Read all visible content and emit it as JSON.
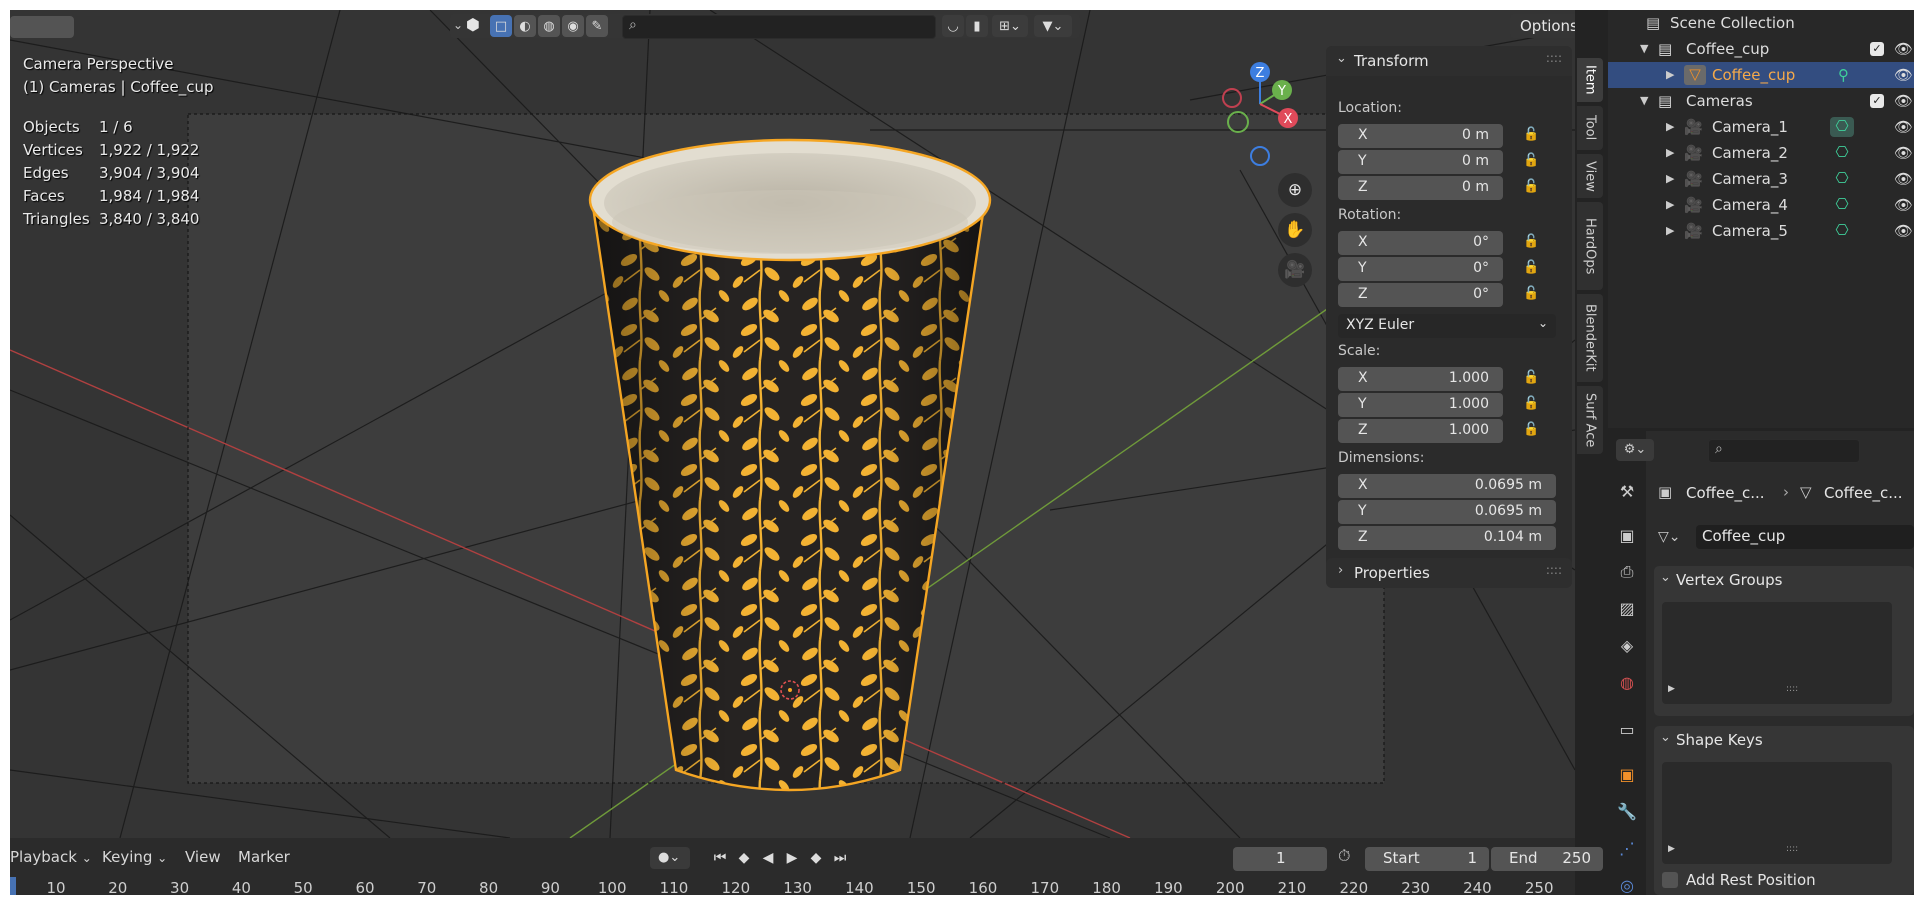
{
  "viewport": {
    "options_label": "Options",
    "camera_title": "Camera Perspective",
    "camera_subtitle": "(1) Cameras | Coffee_cup",
    "stats": [
      {
        "label": "Objects",
        "value": "1 / 6"
      },
      {
        "label": "Vertices",
        "value": "1,922 / 1,922"
      },
      {
        "label": "Edges",
        "value": "3,904 / 3,904"
      },
      {
        "label": "Faces",
        "value": "1,984 / 1,984"
      },
      {
        "label": "Triangles",
        "value": "3,840 / 3,840"
      }
    ],
    "gizmo_labels": {
      "z": "Z",
      "y": "Y",
      "x": "X"
    }
  },
  "npanel": {
    "transform_title": "Transform",
    "location_label": "Location:",
    "location": [
      {
        "axis": "X",
        "value": "0 m"
      },
      {
        "axis": "Y",
        "value": "0 m"
      },
      {
        "axis": "Z",
        "value": "0 m"
      }
    ],
    "rotation_label": "Rotation:",
    "rotation": [
      {
        "axis": "X",
        "value": "0°"
      },
      {
        "axis": "Y",
        "value": "0°"
      },
      {
        "axis": "Z",
        "value": "0°"
      }
    ],
    "rotation_mode": "XYZ Euler",
    "scale_label": "Scale:",
    "scale": [
      {
        "axis": "X",
        "value": "1.000"
      },
      {
        "axis": "Y",
        "value": "1.000"
      },
      {
        "axis": "Z",
        "value": "1.000"
      }
    ],
    "dimensions_label": "Dimensions:",
    "dimensions": [
      {
        "axis": "X",
        "value": "0.0695 m"
      },
      {
        "axis": "Y",
        "value": "0.0695 m"
      },
      {
        "axis": "Z",
        "value": "0.104 m"
      }
    ],
    "properties_title": "Properties",
    "tabs": [
      "Item",
      "Tool",
      "View",
      "HardOps",
      "BlenderKit",
      "Surf Ace"
    ]
  },
  "outliner": {
    "scene_collection": "Scene Collection",
    "rows": [
      {
        "label": "Coffee_cup"
      },
      {
        "label": "Coffee_cup"
      },
      {
        "label": "Cameras"
      },
      {
        "label": "Camera_1"
      },
      {
        "label": "Camera_2"
      },
      {
        "label": "Camera_3"
      },
      {
        "label": "Camera_4"
      },
      {
        "label": "Camera_5"
      }
    ]
  },
  "properties": {
    "breadcrumb_1": "Coffee_c...",
    "breadcrumb_2": "Coffee_c...",
    "mesh_name": "Coffee_cup",
    "vertex_groups_title": "Vertex Groups",
    "shape_keys_title": "Shape Keys",
    "add_rest_position": "Add Rest Position"
  },
  "timeline": {
    "playback": "Playback",
    "keying": "Keying",
    "view": "View",
    "marker": "Marker",
    "current_frame": "1",
    "start_label": "Start",
    "start_value": "1",
    "end_label": "End",
    "end_value": "250",
    "ruler": [
      "10",
      "20",
      "30",
      "40",
      "50",
      "60",
      "70",
      "80",
      "90",
      "100",
      "110",
      "120",
      "130",
      "140",
      "150",
      "160",
      "170",
      "180",
      "190",
      "200",
      "210",
      "220",
      "230",
      "240",
      "250"
    ]
  },
  "colors": {
    "accent": "#4772b3",
    "selection_outline": "#f5a623",
    "leaf": "#f2b233",
    "cup_body": "#262322"
  }
}
